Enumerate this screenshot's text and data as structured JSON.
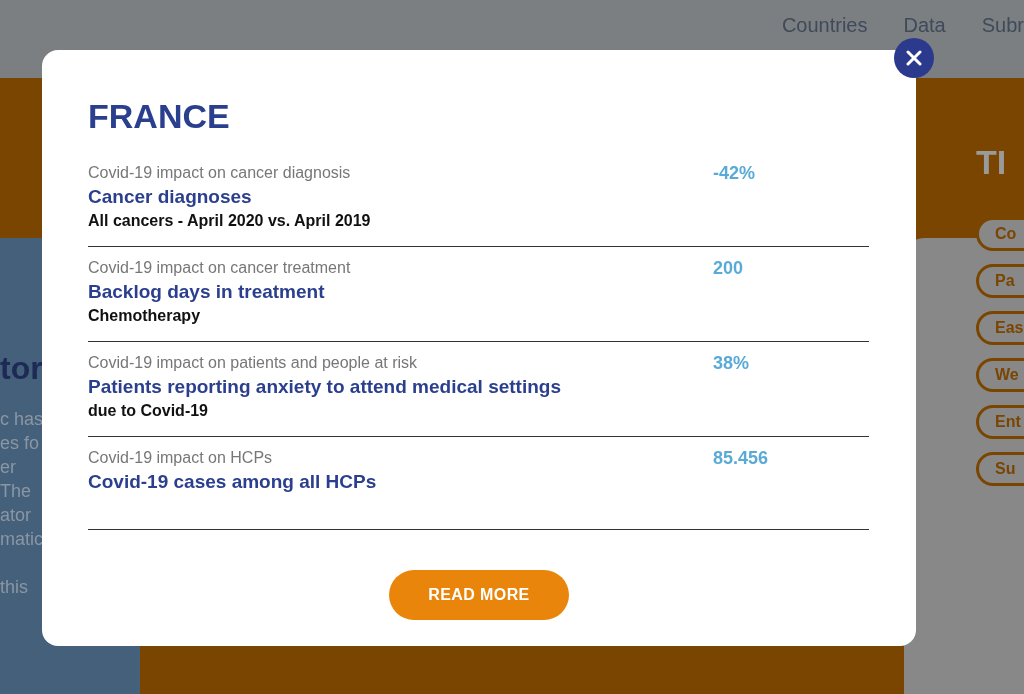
{
  "nav": {
    "items": [
      "Countries",
      "Data",
      "Subr"
    ]
  },
  "background_left": {
    "heading": "tor",
    "lines": [
      "c has",
      "es fo",
      "er",
      "The",
      "ator",
      "matic",
      "this"
    ]
  },
  "background_right": {
    "heading": "TI",
    "pills": [
      "Co",
      "Pa",
      "Eas",
      "We",
      "Ent",
      "Su"
    ]
  },
  "modal": {
    "title": "FRANCE",
    "rows": [
      {
        "category": "Covid-19 impact on cancer diagnosis",
        "title": "Cancer diagnoses",
        "subtitle": "All cancers - April 2020 vs. April 2019",
        "value": "-42%"
      },
      {
        "category": "Covid-19 impact on cancer treatment",
        "title": "Backlog days in treatment",
        "subtitle": "Chemotherapy",
        "value": "200"
      },
      {
        "category": "Covid-19 impact on patients and people at risk",
        "title": "Patients reporting anxiety to attend medical settings",
        "subtitle": "due to Covid-19",
        "value": "38%"
      },
      {
        "category": "Covid-19 impact on HCPs",
        "title": "Covid-19 cases among all HCPs",
        "value": "85.456"
      }
    ],
    "button": "READ MORE"
  }
}
